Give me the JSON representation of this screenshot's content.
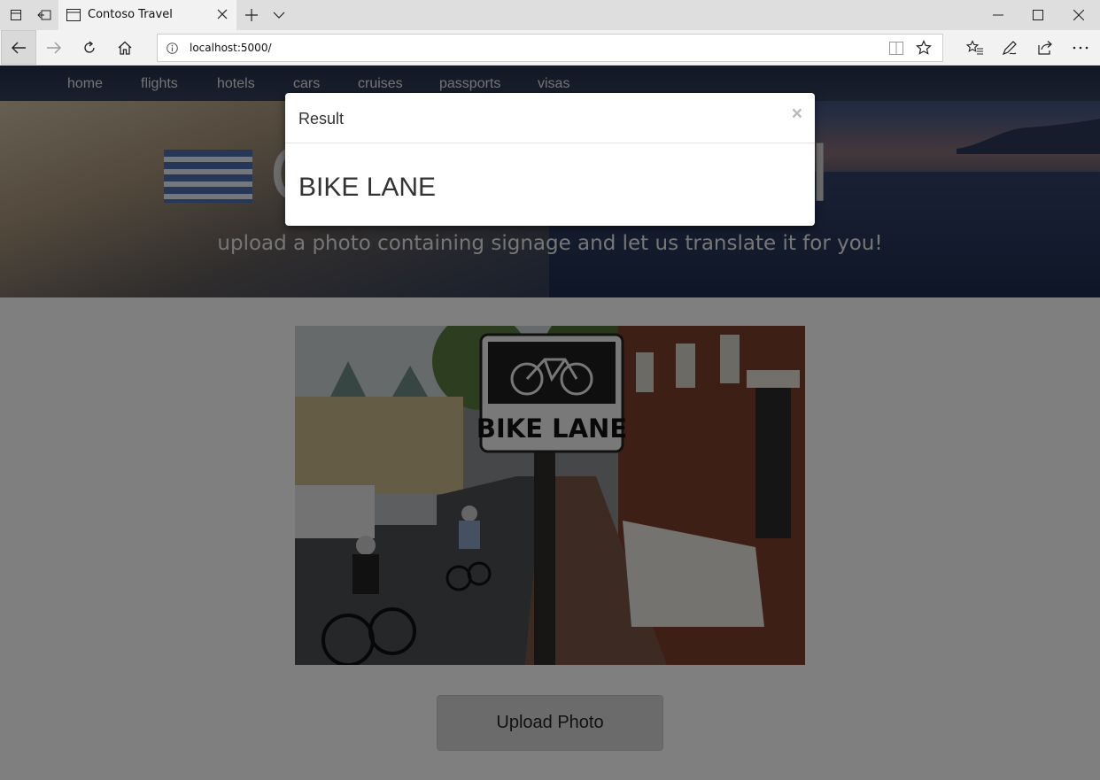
{
  "browser": {
    "tab_title": "Contoso Travel",
    "url": "localhost:5000/"
  },
  "site": {
    "nav": [
      "home",
      "flights",
      "hotels",
      "cars",
      "cruises",
      "passports",
      "visas"
    ],
    "hero_title": "Contoso Travel",
    "hero_subtitle": "upload a photo containing signage and let us translate it for you!",
    "upload_label": "Upload Photo",
    "photo_sign_text": "BIKE LANE"
  },
  "modal": {
    "title": "Result",
    "close_glyph": "×",
    "result_text": "BIKE LANE"
  },
  "colors": {
    "backdrop": "#000000",
    "modal_bg": "#ffffff",
    "text": "#333333"
  }
}
